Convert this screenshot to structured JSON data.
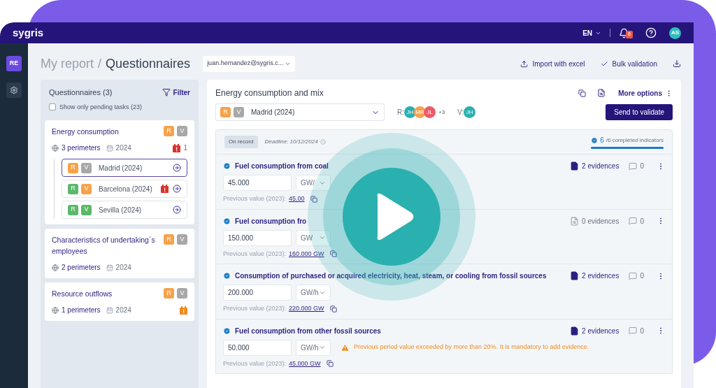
{
  "header": {
    "logo": "sygris",
    "language": "EN",
    "notifications": "8",
    "avatar": "AS"
  },
  "rail": {
    "workspace": "RE"
  },
  "breadcrumb": {
    "parent": "My report",
    "separator": "/",
    "current": "Questionnaires"
  },
  "user_select": {
    "value": "juan.hernandez@sygris.c..."
  },
  "actions": [
    "Import with excel",
    "Bulk validation"
  ],
  "questionnaires": {
    "title": "Questionnaires (3)",
    "filter": "Filter",
    "pending": {
      "label": "Show only pending tasks (23)",
      "checked": false
    },
    "items": [
      {
        "title": "Energy consumption",
        "badges": [
          {
            "label": "R",
            "color": "#f7a24b"
          },
          {
            "label": "V",
            "color": "#a8a8a8"
          }
        ],
        "perimeters": "3 perimeters",
        "year": "2024",
        "alert": {
          "color": "#d8352a",
          "count": "1"
        },
        "children": [
          {
            "name": "Madrid (2024)",
            "selected": true,
            "badges": [
              {
                "label": "R",
                "color": "#f7a24b"
              },
              {
                "label": "V",
                "color": "#a8a8a8"
              }
            ]
          },
          {
            "name": "Barcelona (2024)",
            "selected": false,
            "badges": [
              {
                "label": "R",
                "color": "#5bb86a"
              },
              {
                "label": "V",
                "color": "#f7a24b"
              }
            ],
            "alert": {
              "color": "#d8352a"
            }
          },
          {
            "name": "Sevilla (2024)",
            "selected": false,
            "badges": [
              {
                "label": "R",
                "color": "#5bb86a"
              },
              {
                "label": "V",
                "color": "#5bb86a"
              }
            ]
          }
        ]
      },
      {
        "title": "Characteristics of undertaking´s employees",
        "badges": [
          {
            "label": "R",
            "color": "#f7a24b"
          },
          {
            "label": "V",
            "color": "#a8a8a8"
          }
        ],
        "perimeters": "2 perimeters",
        "year": "2024"
      },
      {
        "title": "Resource outflows",
        "badges": [
          {
            "label": "R",
            "color": "#f7a24b"
          },
          {
            "label": "V",
            "color": "#a8a8a8"
          }
        ],
        "perimeters": "1 perimeters",
        "year": "2024",
        "alert": {
          "color": "#f08a1c"
        }
      }
    ]
  },
  "detail": {
    "title": "Energy consumption and mix",
    "more": "More options",
    "perimeter": {
      "value": "Madrid (2024)",
      "badges": [
        {
          "label": "R",
          "color": "#f7a24b"
        },
        {
          "label": "V",
          "color": "#a8a8a8"
        }
      ]
    },
    "responsibles": {
      "label": "R:",
      "people": [
        {
          "initials": "JH",
          "color": "#2bb0b0"
        },
        {
          "initials": "MR",
          "color": "#f7a24b"
        },
        {
          "initials": "JL",
          "color": "#ec5a6a"
        }
      ],
      "more": "+3"
    },
    "validators": {
      "label": "V:",
      "people": [
        {
          "initials": "JH",
          "color": "#2bb0b0"
        }
      ]
    },
    "send": "Send to validate",
    "status": "On record",
    "deadline": "Deadline: 10/12/2024",
    "completed": "6",
    "completed_rest": "/6 completed indicators",
    "level": 1,
    "indicators": [
      {
        "title": "Fuel consumption from coal",
        "value": "45.000",
        "unit": "GW/",
        "previous_label": "Previous value (2023):",
        "previous": "45.00",
        "evidences": "2 evidences",
        "has_evidence": true,
        "comments": "0"
      },
      {
        "title": "Fuel consumption fro",
        "value": "150.000",
        "unit": "GW",
        "previous_label": "Previous value (2023):",
        "previous": "160.000 GW",
        "evidences": "0 evidences",
        "has_evidence": false,
        "comments": "0"
      },
      {
        "title": "Consumption of purchased or acquired electricity, heat, steam, or cooling from fossil sources",
        "value": "200.000",
        "unit": "GW/h",
        "previous_label": "Previous value (2023):",
        "previous": "220.000 GW",
        "evidences": "2 evidences",
        "has_evidence": true,
        "comments": "0"
      },
      {
        "title": "Fuel consumption from other fossil sources",
        "value": "50.000",
        "unit": "GW/h",
        "warning": "Previous period value exceeded by more than 20%. It is mandatory to add evidence.",
        "previous_label": "Previous value (2023):",
        "previous": "45.000 GW",
        "evidences": "2 evidences",
        "has_evidence": true,
        "comments": "0"
      }
    ]
  }
}
